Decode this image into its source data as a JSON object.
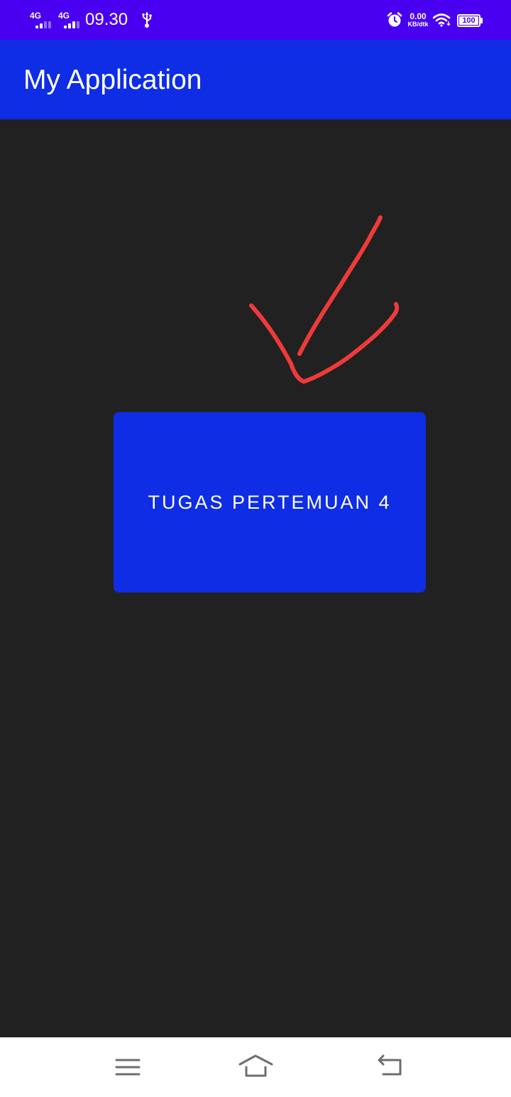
{
  "status_bar": {
    "sim1_network": "4G",
    "sim2_network": "4G",
    "time": "09.30",
    "net_speed_value": "0.00",
    "net_speed_unit": "KB/dtk",
    "battery": "100",
    "icons": [
      "signal-icon",
      "usb-icon",
      "alarm-icon",
      "wifi-icon",
      "battery-icon"
    ],
    "bar_color": "#4a00f0"
  },
  "app_bar": {
    "title": "My Application",
    "color": "#0e2de4"
  },
  "main": {
    "button_label": "TUGAS PERTEMUAN 4",
    "button_color": "#0e2de4",
    "background": "#212121",
    "annotation": "red-arrow-icon"
  },
  "nav_bar": {
    "icons": [
      "menu-icon",
      "home-icon",
      "back-icon"
    ]
  }
}
